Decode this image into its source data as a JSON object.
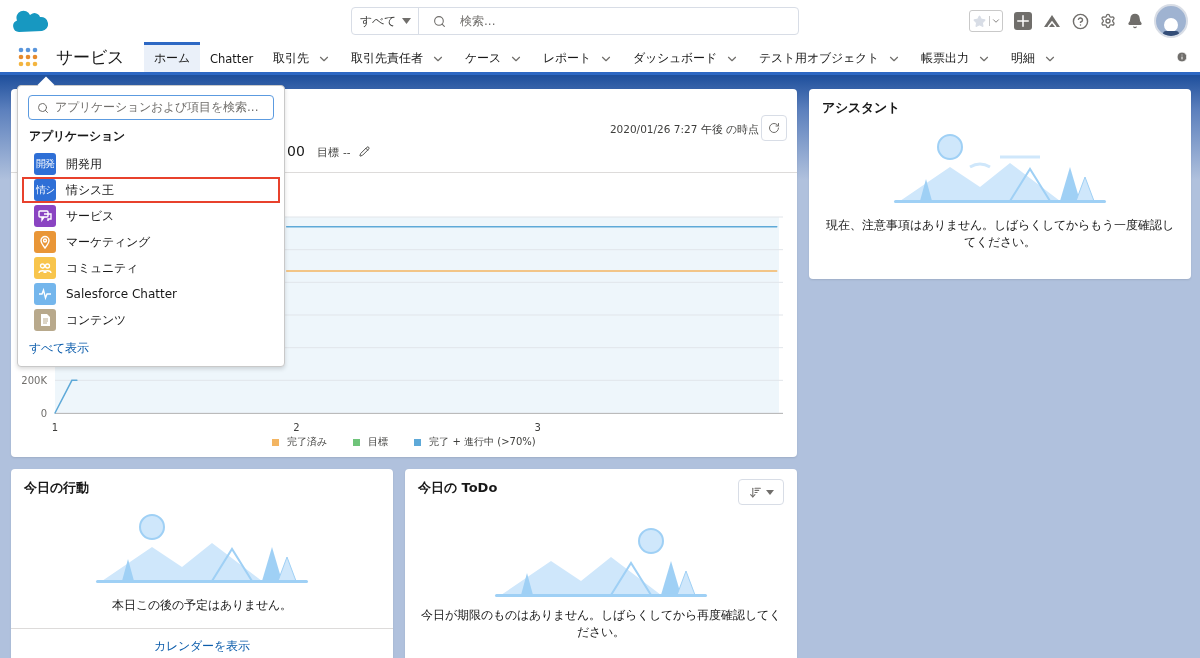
{
  "header": {
    "search_scope": "すべて",
    "search_placeholder": "検索..."
  },
  "nav": {
    "app_name": "サービス",
    "tabs": [
      {
        "label": "ホーム",
        "selected": true,
        "has_menu": false
      },
      {
        "label": "Chatter",
        "selected": false,
        "has_menu": false
      },
      {
        "label": "取引先",
        "selected": false,
        "has_menu": true
      },
      {
        "label": "取引先責任者",
        "selected": false,
        "has_menu": true
      },
      {
        "label": "ケース",
        "selected": false,
        "has_menu": true
      },
      {
        "label": "レポート",
        "selected": false,
        "has_menu": true
      },
      {
        "label": "ダッシュボード",
        "selected": false,
        "has_menu": true
      },
      {
        "label": "テスト用オブジェクト",
        "selected": false,
        "has_menu": true
      },
      {
        "label": "帳票出力",
        "selected": false,
        "has_menu": true
      },
      {
        "label": "明細",
        "selected": false,
        "has_menu": true
      }
    ]
  },
  "app_launcher": {
    "search_placeholder": "アプリケーションおよび項目を検索...",
    "heading": "アプリケーション",
    "items": [
      {
        "label": "開発用",
        "icon_text": "開発",
        "kind": "text",
        "color": "#2e6fd6",
        "highlighted": false
      },
      {
        "label": "情シス王",
        "icon_text": "情シ",
        "kind": "text",
        "color": "#2e6fd6",
        "highlighted": true
      },
      {
        "label": "サービス",
        "kind": "chat",
        "color": "#8a44c2",
        "highlighted": false
      },
      {
        "label": "マーケティング",
        "kind": "pin",
        "color": "#e99637",
        "highlighted": false
      },
      {
        "label": "コミュニティ",
        "kind": "people",
        "color": "#f8c54c",
        "highlighted": false
      },
      {
        "label": "Salesforce Chatter",
        "kind": "pulse",
        "color": "#74b6ec",
        "highlighted": false
      },
      {
        "label": "コンテンツ",
        "kind": "doc",
        "color": "#b8a98c",
        "highlighted": false
      }
    ],
    "show_all": "すべて表示"
  },
  "performance": {
    "value_fragment": "00",
    "goal_label": "目標",
    "goal_value": "--",
    "timestamp": "2020/01/26 7:27 午後 の時点",
    "chart_data": {
      "type": "line",
      "x": [
        1,
        1.07,
        1.12,
        1.96,
        3,
        3.97
      ],
      "xlim": [
        1,
        4
      ],
      "xticks": [
        1,
        2,
        3
      ],
      "ylim": [
        0,
        1200000
      ],
      "yticks": [
        0,
        {
          "value": 200000,
          "label": "200K"
        }
      ],
      "series": [
        {
          "name": "完了済み",
          "color": "#f3b562",
          "values": [
            null,
            null,
            null,
            870000,
            870000,
            870000
          ]
        },
        {
          "name": "目標",
          "color": "#6fc47a",
          "values": [
            null,
            null,
            null,
            null,
            null,
            null
          ]
        },
        {
          "name": "完了 + 進行中 (>70%)",
          "color": "#5ea9d8",
          "values": [
            0,
            200000,
            null,
            1140000,
            1140000,
            1140000
          ]
        }
      ]
    }
  },
  "assistant": {
    "title": "アシスタント",
    "message": "現在、注意事項はありません。しばらくしてからもう一度確認してください。"
  },
  "events": {
    "title": "今日の行動",
    "message": "本日この後の予定はありません。",
    "link": "カレンダーを表示"
  },
  "todo": {
    "title": "今日の ToDo",
    "message": "今日が期限のものはありません。しばらくしてから再度確認してください。"
  }
}
